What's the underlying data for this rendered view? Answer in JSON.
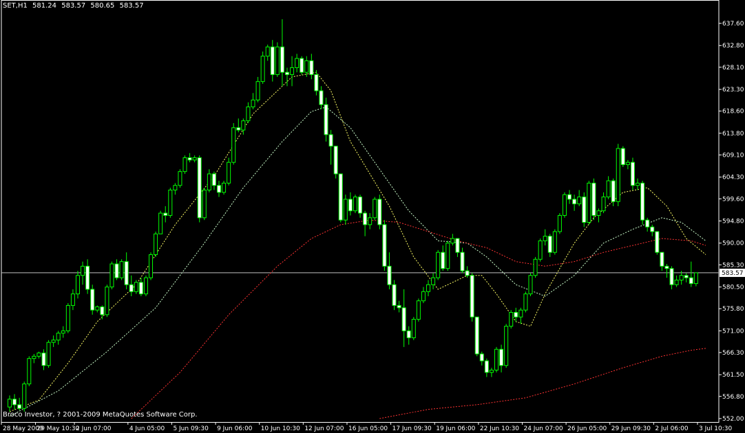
{
  "header": {
    "symbol": "SET,H1",
    "open": "581.24",
    "high": "583.57",
    "low": "580.65",
    "close": "583.57"
  },
  "copyright": "Broco Investor, ? 2001-2009 MetaQuotes Software Corp.",
  "colors": {
    "background": "#000000",
    "axis": "#ffffff",
    "candle_up": "#000000",
    "candle_down": "#ffffff",
    "candle_outline": "#00ff00",
    "bid_line": "#c0c0c0",
    "ma_fast": "#ffff66",
    "ma_medium": "#ccffcc",
    "ma_slow": "#ff3333",
    "ma_long": "#ff3333"
  },
  "chart_data": {
    "type": "candlestick",
    "ylim": [
      552.0,
      640.0
    ],
    "y_ticks": [
      "637.60",
      "632.80",
      "628.10",
      "623.30",
      "618.60",
      "613.80",
      "609.10",
      "604.30",
      "599.60",
      "594.80",
      "590.00",
      "585.30",
      "580.50",
      "575.80",
      "571.00",
      "566.30",
      "561.50",
      "556.80",
      "552.00"
    ],
    "current_price": "583.57",
    "x_ticks": [
      {
        "label": "28 May 2009",
        "i": 0
      },
      {
        "label": "29 May 10:30",
        "i": 7
      },
      {
        "label": "2 Jun 07:00",
        "i": 15
      },
      {
        "label": "4 Jun 05:00",
        "i": 26
      },
      {
        "label": "5 Jun 09:30",
        "i": 35
      },
      {
        "label": "9 Jun 06:00",
        "i": 44
      },
      {
        "label": "10 Jun 10:30",
        "i": 53
      },
      {
        "label": "12 Jun 07:00",
        "i": 62
      },
      {
        "label": "16 Jun 05:00",
        "i": 71
      },
      {
        "label": "17 Jun 09:30",
        "i": 80
      },
      {
        "label": "19 Jun 06:00",
        "i": 89
      },
      {
        "label": "22 Jun 10:30",
        "i": 98
      },
      {
        "label": "24 Jun 07:00",
        "i": 107
      },
      {
        "label": "26 Jun 05:00",
        "i": 116
      },
      {
        "label": "29 Jun 09:30",
        "i": 125
      },
      {
        "label": "2 Jul 06:00",
        "i": 134
      },
      {
        "label": "3 Jul 10:30",
        "i": 143
      }
    ],
    "candles": [
      [
        554.5,
        557.0,
        553.5,
        556.2
      ],
      [
        556.2,
        557.3,
        554.0,
        555.0
      ],
      [
        555.0,
        556.5,
        553.8,
        554.2
      ],
      [
        554.2,
        560.0,
        553.5,
        559.5
      ],
      [
        559.5,
        565.5,
        559.0,
        565.0
      ],
      [
        565.0,
        566.0,
        564.0,
        565.5
      ],
      [
        565.5,
        566.5,
        565.0,
        566.2
      ],
      [
        566.2,
        567.0,
        562.5,
        563.5
      ],
      [
        563.5,
        569.0,
        563.0,
        568.5
      ],
      [
        568.5,
        570.0,
        567.5,
        569.0
      ],
      [
        569.0,
        571.0,
        568.0,
        570.5
      ],
      [
        570.5,
        572.0,
        569.5,
        571.0
      ],
      [
        571.0,
        577.0,
        570.5,
        576.5
      ],
      [
        576.5,
        580.0,
        575.5,
        579.0
      ],
      [
        579.0,
        584.0,
        578.0,
        583.0
      ],
      [
        583.0,
        586.0,
        581.0,
        585.0
      ],
      [
        585.0,
        586.5,
        579.0,
        580.0
      ],
      [
        580.0,
        581.0,
        574.5,
        575.5
      ],
      [
        575.5,
        576.5,
        575.0,
        576.2
      ],
      [
        576.2,
        576.5,
        573.5,
        574.5
      ],
      [
        574.5,
        581.0,
        574.0,
        580.5
      ],
      [
        580.5,
        586.0,
        580.0,
        585.5
      ],
      [
        585.5,
        586.5,
        582.0,
        582.5
      ],
      [
        582.5,
        586.5,
        582.0,
        586.0
      ],
      [
        586.0,
        588.0,
        580.0,
        581.0
      ],
      [
        581.0,
        583.0,
        578.5,
        579.5
      ],
      [
        579.5,
        582.0,
        579.0,
        581.5
      ],
      [
        581.5,
        582.5,
        578.5,
        579.0
      ],
      [
        579.0,
        583.0,
        578.5,
        582.5
      ],
      [
        582.5,
        588.0,
        582.0,
        587.5
      ],
      [
        587.5,
        592.5,
        587.0,
        592.0
      ],
      [
        592.0,
        597.0,
        596.0,
        596.5
      ],
      [
        596.5,
        598.0,
        594.5,
        596.0
      ],
      [
        596.0,
        602.0,
        595.5,
        601.5
      ],
      [
        601.5,
        603.0,
        600.5,
        602.5
      ],
      [
        602.5,
        606.0,
        602.0,
        605.5
      ],
      [
        605.5,
        609.0,
        605.0,
        608.5
      ],
      [
        608.5,
        609.5,
        607.5,
        608.0
      ],
      [
        608.0,
        609.0,
        607.5,
        608.5
      ],
      [
        608.5,
        609.0,
        594.5,
        595.5
      ],
      [
        595.5,
        602.0,
        595.0,
        601.5
      ],
      [
        601.5,
        606.0,
        601.0,
        605.0
      ],
      [
        605.0,
        605.5,
        601.5,
        602.5
      ],
      [
        602.5,
        603.5,
        600.0,
        601.0
      ],
      [
        601.0,
        603.5,
        600.5,
        603.0
      ],
      [
        603.0,
        608.5,
        602.5,
        607.5
      ],
      [
        607.5,
        616.0,
        607.0,
        615.0
      ],
      [
        615.0,
        617.0,
        614.0,
        614.5
      ],
      [
        614.5,
        617.0,
        613.5,
        616.5
      ],
      [
        616.5,
        620.5,
        616.0,
        619.5
      ],
      [
        619.5,
        622.5,
        619.0,
        621.0
      ],
      [
        621.0,
        626.0,
        620.5,
        625.0
      ],
      [
        625.0,
        631.5,
        624.5,
        630.5
      ],
      [
        630.5,
        633.0,
        629.5,
        632.5
      ],
      [
        632.5,
        634.0,
        625.0,
        626.5
      ],
      [
        626.5,
        633.5,
        626.0,
        632.5
      ],
      [
        632.5,
        638.5,
        624.0,
        627.0
      ],
      [
        627.0,
        628.0,
        624.0,
        626.5
      ],
      [
        626.5,
        630.5,
        624.0,
        628.0
      ],
      [
        628.0,
        631.0,
        627.0,
        630.0
      ],
      [
        630.0,
        630.5,
        626.5,
        627.0
      ],
      [
        627.0,
        630.5,
        626.0,
        629.5
      ],
      [
        629.5,
        631.0,
        625.5,
        626.5
      ],
      [
        626.5,
        627.5,
        622.0,
        623.0
      ],
      [
        623.0,
        624.0,
        619.0,
        620.0
      ],
      [
        620.0,
        621.5,
        612.0,
        613.5
      ],
      [
        613.5,
        614.5,
        607.0,
        611.0
      ],
      [
        611.0,
        606.0,
        604.0,
        605.0
      ],
      [
        605.0,
        603.0,
        594.5,
        595.0
      ],
      [
        595.0,
        600.5,
        594.0,
        599.5
      ],
      [
        599.5,
        601.0,
        596.0,
        597.0
      ],
      [
        597.0,
        600.5,
        596.5,
        600.0
      ],
      [
        600.0,
        600.5,
        595.5,
        596.5
      ],
      [
        596.5,
        597.0,
        591.5,
        594.0
      ],
      [
        594.0,
        596.5,
        593.0,
        595.5
      ],
      [
        595.5,
        600.0,
        595.0,
        599.5
      ],
      [
        599.5,
        600.5,
        593.0,
        594.0
      ],
      [
        594.0,
        595.0,
        584.0,
        585.0
      ],
      [
        585.0,
        588.0,
        580.0,
        581.0
      ],
      [
        581.0,
        582.0,
        575.5,
        576.5
      ],
      [
        576.5,
        577.5,
        575.0,
        576.0
      ],
      [
        576.0,
        580.0,
        567.5,
        571.0
      ],
      [
        571.0,
        572.0,
        568.0,
        569.5
      ],
      [
        569.5,
        574.0,
        569.0,
        573.5
      ],
      [
        573.5,
        578.0,
        573.0,
        577.5
      ],
      [
        577.5,
        580.5,
        577.0,
        579.5
      ],
      [
        579.5,
        582.0,
        578.5,
        581.0
      ],
      [
        581.0,
        583.5,
        580.0,
        582.5
      ],
      [
        582.5,
        588.5,
        582.0,
        588.0
      ],
      [
        588.0,
        589.5,
        584.0,
        584.5
      ],
      [
        584.5,
        590.5,
        584.0,
        590.0
      ],
      [
        590.0,
        592.0,
        589.5,
        591.0
      ],
      [
        591.0,
        588.5,
        587.0,
        588.0
      ],
      [
        588.0,
        589.0,
        583.5,
        584.0
      ],
      [
        584.0,
        585.0,
        582.5,
        583.0
      ],
      [
        583.0,
        583.5,
        573.0,
        574.0
      ],
      [
        574.0,
        567.0,
        565.5,
        566.0
      ],
      [
        566.0,
        566.5,
        563.5,
        564.5
      ],
      [
        564.5,
        565.0,
        561.0,
        562.0
      ],
      [
        562.0,
        563.0,
        561.0,
        562.5
      ],
      [
        562.5,
        567.5,
        562.0,
        567.0
      ],
      [
        567.0,
        568.0,
        562.0,
        563.5
      ],
      [
        563.5,
        572.5,
        563.0,
        572.0
      ],
      [
        572.0,
        575.5,
        571.5,
        575.0
      ],
      [
        575.0,
        576.0,
        573.0,
        574.0
      ],
      [
        574.0,
        576.0,
        572.5,
        575.5
      ],
      [
        575.5,
        579.5,
        575.0,
        579.0
      ],
      [
        579.0,
        583.5,
        578.5,
        583.0
      ],
      [
        583.0,
        587.0,
        582.5,
        586.5
      ],
      [
        586.5,
        591.0,
        586.0,
        590.5
      ],
      [
        590.5,
        593.0,
        589.5,
        591.5
      ],
      [
        591.5,
        592.0,
        587.0,
        588.0
      ],
      [
        588.0,
        593.0,
        587.5,
        592.5
      ],
      [
        592.5,
        596.5,
        592.0,
        596.0
      ],
      [
        596.0,
        601.0,
        595.5,
        600.5
      ],
      [
        600.5,
        601.5,
        598.5,
        599.5
      ],
      [
        599.5,
        600.5,
        597.0,
        598.5
      ],
      [
        598.5,
        601.5,
        598.0,
        600.0
      ],
      [
        600.0,
        601.0,
        593.5,
        594.5
      ],
      [
        594.5,
        603.5,
        594.0,
        603.0
      ],
      [
        603.0,
        604.0,
        595.0,
        596.0
      ],
      [
        596.0,
        597.5,
        594.5,
        597.0
      ],
      [
        597.0,
        601.0,
        596.5,
        600.0
      ],
      [
        600.0,
        604.5,
        599.5,
        603.5
      ],
      [
        603.5,
        604.0,
        598.0,
        599.0
      ],
      [
        599.0,
        611.5,
        598.0,
        610.5
      ],
      [
        610.5,
        611.0,
        606.5,
        607.0
      ],
      [
        607.0,
        608.0,
        606.0,
        607.5
      ],
      [
        607.5,
        608.5,
        601.5,
        602.5
      ],
      [
        602.5,
        604.0,
        601.5,
        603.0
      ],
      [
        603.0,
        603.5,
        594.0,
        595.0
      ],
      [
        595.0,
        595.5,
        592.5,
        593.5
      ],
      [
        593.5,
        594.0,
        591.5,
        592.5
      ],
      [
        592.5,
        589.0,
        587.5,
        588.0
      ],
      [
        588.0,
        586.0,
        584.0,
        585.0
      ],
      [
        585.0,
        585.5,
        582.5,
        584.5
      ],
      [
        584.5,
        585.0,
        580.0,
        581.0
      ],
      [
        581.0,
        583.0,
        580.5,
        582.0
      ],
      [
        582.0,
        584.0,
        581.0,
        583.0
      ],
      [
        583.0,
        583.5,
        581.5,
        582.5
      ],
      [
        582.5,
        586.0,
        580.5,
        581.24
      ],
      [
        581.24,
        583.57,
        580.65,
        583.57
      ]
    ],
    "moving_averages": [
      {
        "color": "ma_fast",
        "points": [
          [
            0,
            553.5
          ],
          [
            6,
            556.0
          ],
          [
            12,
            564.0
          ],
          [
            18,
            573.0
          ],
          [
            26,
            581.0
          ],
          [
            34,
            594.0
          ],
          [
            42,
            604.5
          ],
          [
            50,
            618.0
          ],
          [
            58,
            626.0
          ],
          [
            63,
            627.0
          ],
          [
            66,
            623.0
          ],
          [
            70,
            612.0
          ],
          [
            74,
            605.0
          ],
          [
            78,
            598.0
          ],
          [
            83,
            587.0
          ],
          [
            88,
            580.0
          ],
          [
            94,
            583.0
          ],
          [
            97,
            583.0
          ],
          [
            100,
            579.0
          ],
          [
            104,
            573.0
          ],
          [
            107,
            572.0
          ],
          [
            110,
            579.0
          ],
          [
            116,
            590.0
          ],
          [
            120,
            595.5
          ],
          [
            126,
            601.0
          ],
          [
            131,
            602.0
          ],
          [
            135,
            598.0
          ],
          [
            139,
            591.0
          ],
          [
            143,
            587.5
          ]
        ]
      },
      {
        "color": "ma_medium",
        "points": [
          [
            0,
            552.5
          ],
          [
            10,
            558.0
          ],
          [
            20,
            566.5
          ],
          [
            30,
            576.0
          ],
          [
            40,
            590.0
          ],
          [
            48,
            602.0
          ],
          [
            56,
            612.0
          ],
          [
            62,
            618.5
          ],
          [
            65,
            619.5
          ],
          [
            70,
            615.0
          ],
          [
            76,
            606.0
          ],
          [
            82,
            597.0
          ],
          [
            88,
            590.5
          ],
          [
            94,
            590.0
          ],
          [
            98,
            587.0
          ],
          [
            104,
            581.0
          ],
          [
            110,
            578.5
          ],
          [
            116,
            583.0
          ],
          [
            122,
            590.0
          ],
          [
            128,
            593.0
          ],
          [
            134,
            595.5
          ],
          [
            138,
            594.5
          ],
          [
            143,
            590.5
          ]
        ]
      },
      {
        "color": "ma_slow",
        "points": [
          [
            25,
            552.0
          ],
          [
            35,
            562.0
          ],
          [
            45,
            574.5
          ],
          [
            55,
            585.0
          ],
          [
            62,
            591.0
          ],
          [
            68,
            594.0
          ],
          [
            74,
            595.0
          ],
          [
            80,
            594.5
          ],
          [
            86,
            592.5
          ],
          [
            92,
            590.5
          ],
          [
            98,
            589.0
          ],
          [
            104,
            586.0
          ],
          [
            110,
            585.0
          ],
          [
            116,
            586.0
          ],
          [
            122,
            588.0
          ],
          [
            128,
            589.5
          ],
          [
            134,
            591.0
          ],
          [
            140,
            590.5
          ],
          [
            143,
            589.5
          ]
        ]
      },
      {
        "color": "ma_long",
        "points": [
          [
            76,
            552.0
          ],
          [
            86,
            554.0
          ],
          [
            96,
            555.0
          ],
          [
            106,
            556.5
          ],
          [
            116,
            559.5
          ],
          [
            126,
            563.0
          ],
          [
            134,
            565.5
          ],
          [
            140,
            566.8
          ],
          [
            143,
            567.2
          ]
        ]
      }
    ]
  }
}
